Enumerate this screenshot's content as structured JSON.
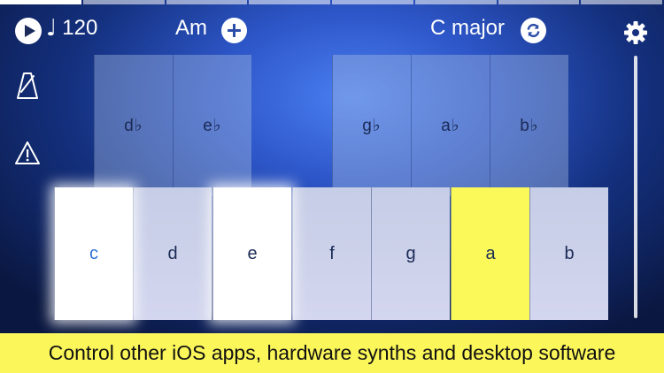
{
  "toolbar": {
    "tempo_value": "120",
    "tempo_glyph": "♩",
    "chord": "Am",
    "scale": "C major"
  },
  "icons": {
    "play": "play-icon",
    "add": "plus-icon",
    "refresh": "refresh-icon",
    "settings": "gear-icon",
    "metronome": "metronome-icon",
    "warning": "warning-icon"
  },
  "keyboard": {
    "black_keys": [
      "d♭",
      "e♭",
      "g♭",
      "a♭",
      "b♭"
    ],
    "white_keys": [
      "c",
      "d",
      "e",
      "f",
      "g",
      "a",
      "b"
    ],
    "highlighted_white": [
      "c",
      "e"
    ],
    "active_key": "a"
  },
  "banner": {
    "text": "Control other iOS apps, hardware synths and desktop software"
  },
  "colors": {
    "background_center": "#4a7ff2",
    "background_edge": "#0a1740",
    "active_key": "#fbf95a",
    "root_note_text": "#2f6fd8",
    "banner": "#fbf65a"
  }
}
